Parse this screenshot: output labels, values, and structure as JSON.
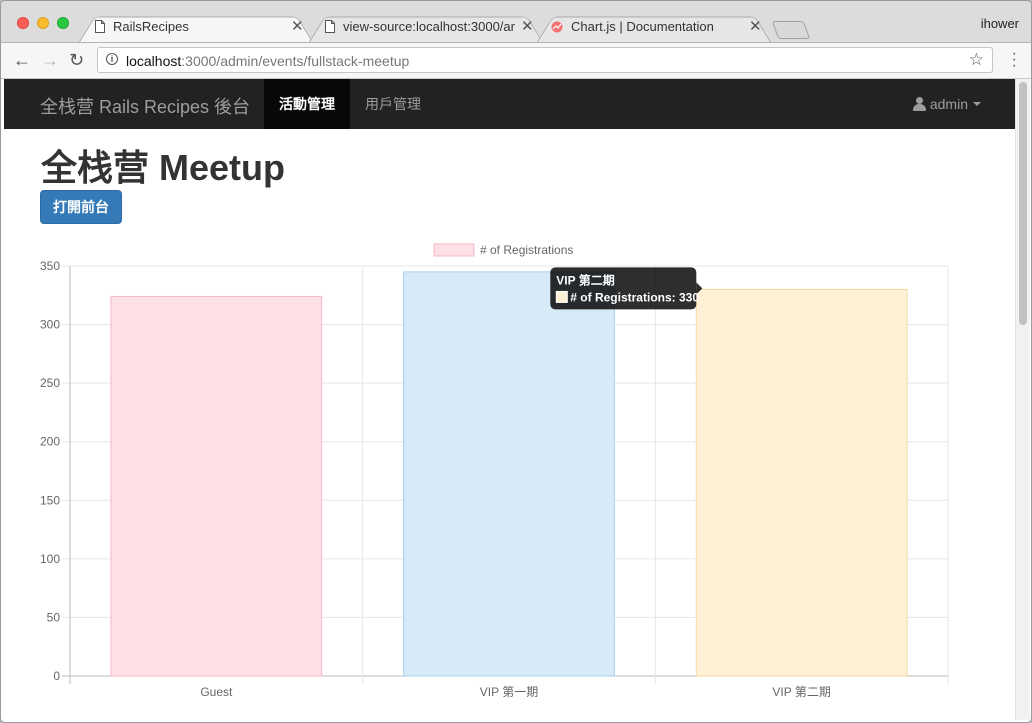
{
  "browser": {
    "tabs": [
      {
        "title": "RailsRecipes",
        "active": true
      },
      {
        "title": "view-source:localhost:3000/ar",
        "active": false
      },
      {
        "title": "Chart.js | Documentation",
        "active": false
      }
    ],
    "profile": "ihower",
    "url_host": "localhost",
    "url_rest": ":3000/admin/events/fullstack-meetup"
  },
  "navbar": {
    "brand": "全栈营 Rails Recipes 後台",
    "items": [
      {
        "label": "活動管理",
        "active": true
      },
      {
        "label": "用戶管理",
        "active": false
      }
    ],
    "user": "admin"
  },
  "page": {
    "title": "全栈营 Meetup",
    "open_frontend_button": "打開前台"
  },
  "chart_data": {
    "type": "bar",
    "categories": [
      "Guest",
      "VIP 第一期",
      "VIP 第二期"
    ],
    "series": [
      {
        "name": "# of Registrations",
        "values": [
          324,
          345,
          330
        ]
      }
    ],
    "bar_fill_colors": [
      "#fde0e6",
      "#d6eaf8",
      "#fff1d6"
    ],
    "bar_border_colors": [
      "#f4b9c6",
      "#a9cfee",
      "#f5d9a3"
    ],
    "legend_color": "#fde0e6",
    "ylim": [
      0,
      350
    ],
    "yticks": [
      0,
      50,
      100,
      150,
      200,
      250,
      300,
      350
    ],
    "grid": true,
    "legend_position": "top",
    "tooltip": {
      "title": "VIP 第二期",
      "label": "# of Registrations: 330"
    }
  }
}
